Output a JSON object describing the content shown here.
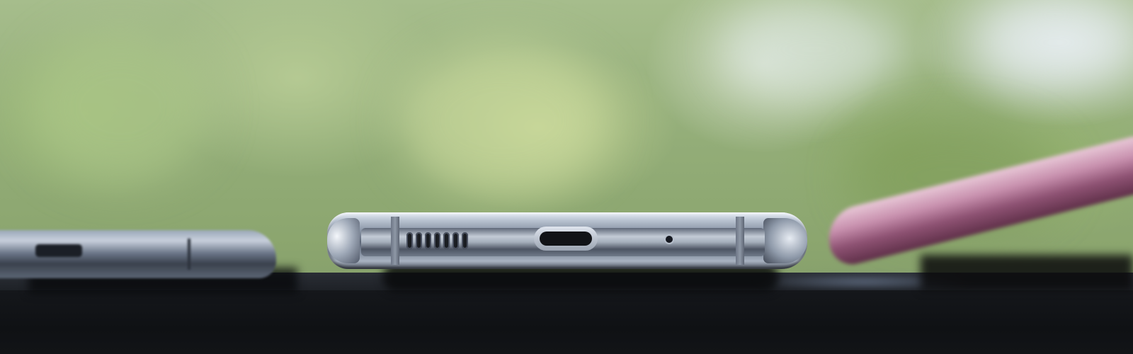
{
  "scene": {
    "subject": "usb-c-port-phone-bottom",
    "colors": {
      "background_foliage": "#93ad78",
      "background_sky": "#e1e8eb",
      "table": "#16181c",
      "center_phone": "#8f9aab",
      "left_phone": "#6b7688",
      "right_phone": "#c78fad"
    }
  }
}
